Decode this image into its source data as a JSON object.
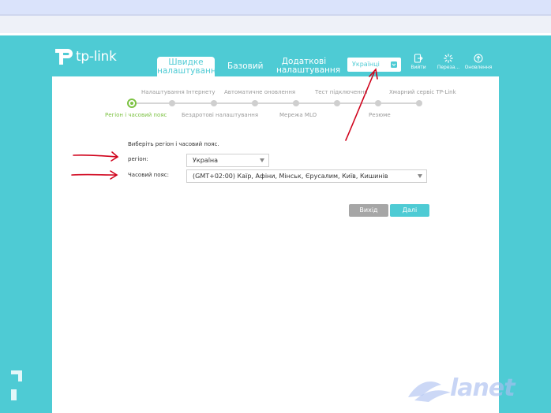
{
  "brand": {
    "logo_text": "tp-link"
  },
  "nav": {
    "tabs": [
      {
        "line1": "Швидке",
        "line2": "налаштування",
        "active": true
      },
      {
        "line1": "Базовий",
        "line2": "",
        "active": false
      },
      {
        "line1": "Додаткові",
        "line2": "налаштування",
        "active": false
      }
    ],
    "language": "Українці"
  },
  "tools": {
    "logout": "Вийти",
    "reboot": "Переза...",
    "update": "Оновлення"
  },
  "steps": {
    "top": [
      "Налаштування Інтернету",
      "Автоматичне оновлення",
      "Тест підключення",
      "Хмарний сервіс TP-Link"
    ],
    "bottom": [
      "Регіон і часовий пояс",
      "Бездротові налаштування",
      "Мережа MLO",
      "Резюме"
    ]
  },
  "form": {
    "title": "Виберіть регіон і часовий пояс.",
    "region_label": "регіон:",
    "region_value": "Україна",
    "timezone_label": "Часовий пояс:",
    "timezone_value": "(GMT+02:00) Каїр, Афіни, Мінськ, Єрусалим, Київ, Кишинів"
  },
  "buttons": {
    "exit": "Вихід",
    "next": "Далі"
  },
  "watermark": {
    "text": "lanet"
  },
  "colors": {
    "accent": "#4ecbd4",
    "step_active": "#7cc242",
    "arrow": "#d0021b"
  }
}
